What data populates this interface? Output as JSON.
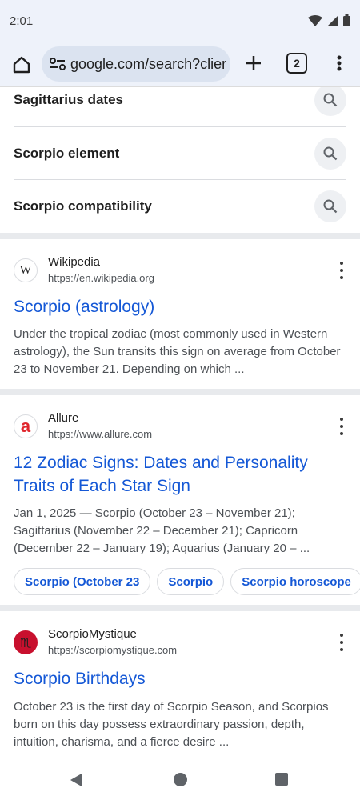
{
  "status": {
    "time": "2:01"
  },
  "browser": {
    "url": "google.com/search?clier",
    "tab_count": "2"
  },
  "related_searches": [
    {
      "label": "Sagittarius dates"
    },
    {
      "label": "Scorpio element"
    },
    {
      "label": "Scorpio compatibility"
    }
  ],
  "results": [
    {
      "source": "Wikipedia",
      "url": "https://en.wikipedia.org",
      "favicon": "W",
      "title": "Scorpio (astrology)",
      "snippet": "Under the tropical zodiac (most commonly used in Western astrology), the Sun transits this sign on average from October 23 to November 21. Depending on which ..."
    },
    {
      "source": "Allure",
      "url": "https://www.allure.com",
      "favicon": "a",
      "title": "12 Zodiac Signs: Dates and Personality Traits of Each Star Sign",
      "snippet": "Jan 1, 2025 — Scorpio (October 23 – November 21); Sagittarius (November 22 – December 21); Capricorn (December 22 – January 19); Aquarius (January 20 – ...",
      "chips": [
        "Scorpio (October 23",
        "Scorpio",
        "Scorpio horoscope"
      ]
    },
    {
      "source": "ScorpioMystique",
      "url": "https://scorpiomystique.com",
      "favicon": "♏",
      "title": "Scorpio Birthdays",
      "snippet": "October 23 is the first day of Scorpio Season, and Scorpios born on this day possess extraordinary passion, depth, intuition, charisma, and a fierce desire ..."
    }
  ],
  "colors": {
    "link": "#1558d6",
    "allure_red": "#e0262d",
    "scorpio_red": "#c8102e"
  }
}
